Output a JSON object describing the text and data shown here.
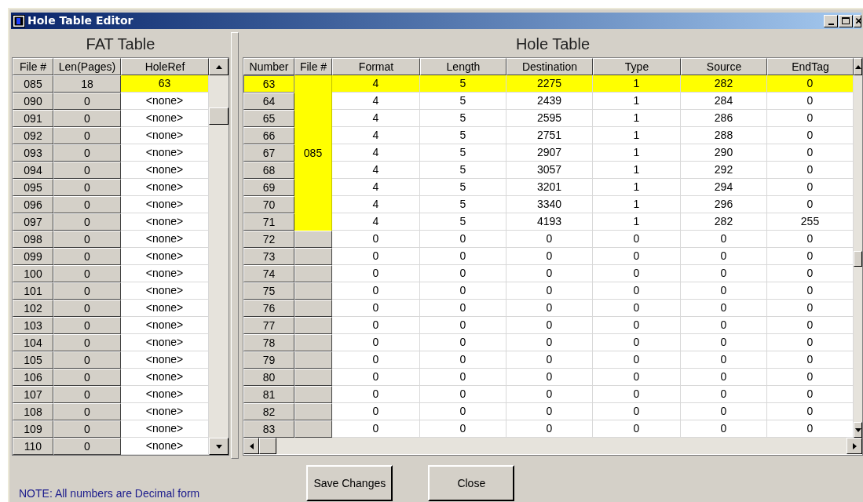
{
  "window": {
    "title": "Hole Table Editor"
  },
  "fat_table": {
    "title": "FAT Table",
    "columns": [
      "File #",
      "Len(Pages)",
      "HoleRef"
    ],
    "rows": [
      {
        "file": "085",
        "len": "18",
        "holeref": "63",
        "selected": true
      },
      {
        "file": "090",
        "len": "0",
        "holeref": "<none>",
        "selected": false
      },
      {
        "file": "091",
        "len": "0",
        "holeref": "<none>",
        "selected": false
      },
      {
        "file": "092",
        "len": "0",
        "holeref": "<none>",
        "selected": false
      },
      {
        "file": "093",
        "len": "0",
        "holeref": "<none>",
        "selected": false
      },
      {
        "file": "094",
        "len": "0",
        "holeref": "<none>",
        "selected": false
      },
      {
        "file": "095",
        "len": "0",
        "holeref": "<none>",
        "selected": false
      },
      {
        "file": "096",
        "len": "0",
        "holeref": "<none>",
        "selected": false
      },
      {
        "file": "097",
        "len": "0",
        "holeref": "<none>",
        "selected": false
      },
      {
        "file": "098",
        "len": "0",
        "holeref": "<none>",
        "selected": false
      },
      {
        "file": "099",
        "len": "0",
        "holeref": "<none>",
        "selected": false
      },
      {
        "file": "100",
        "len": "0",
        "holeref": "<none>",
        "selected": false
      },
      {
        "file": "101",
        "len": "0",
        "holeref": "<none>",
        "selected": false
      },
      {
        "file": "102",
        "len": "0",
        "holeref": "<none>",
        "selected": false
      },
      {
        "file": "103",
        "len": "0",
        "holeref": "<none>",
        "selected": false
      },
      {
        "file": "104",
        "len": "0",
        "holeref": "<none>",
        "selected": false
      },
      {
        "file": "105",
        "len": "0",
        "holeref": "<none>",
        "selected": false
      },
      {
        "file": "106",
        "len": "0",
        "holeref": "<none>",
        "selected": false
      },
      {
        "file": "107",
        "len": "0",
        "holeref": "<none>",
        "selected": false
      },
      {
        "file": "108",
        "len": "0",
        "holeref": "<none>",
        "selected": false
      },
      {
        "file": "109",
        "len": "0",
        "holeref": "<none>",
        "selected": false
      },
      {
        "file": "110",
        "len": "0",
        "holeref": "<none>",
        "selected": false
      }
    ]
  },
  "hole_table": {
    "title": "Hole Table",
    "columns": [
      "Number",
      "File #",
      "Format",
      "Length",
      "Destination",
      "Type",
      "Source",
      "EndTag"
    ],
    "rows": [
      {
        "in_file_group": true,
        "selected": true,
        "cells": [
          "63",
          "",
          "4",
          "5",
          "2275",
          "1",
          "282",
          "0"
        ]
      },
      {
        "in_file_group": true,
        "selected": false,
        "cells": [
          "64",
          "",
          "4",
          "5",
          "2439",
          "1",
          "284",
          "0"
        ]
      },
      {
        "in_file_group": true,
        "selected": false,
        "cells": [
          "65",
          "",
          "4",
          "5",
          "2595",
          "1",
          "286",
          "0"
        ]
      },
      {
        "in_file_group": true,
        "selected": false,
        "cells": [
          "66",
          "",
          "4",
          "5",
          "2751",
          "1",
          "288",
          "0"
        ]
      },
      {
        "in_file_group": true,
        "selected": false,
        "cells": [
          "67",
          "085",
          "4",
          "5",
          "2907",
          "1",
          "290",
          "0"
        ]
      },
      {
        "in_file_group": true,
        "selected": false,
        "cells": [
          "68",
          "",
          "4",
          "5",
          "3057",
          "1",
          "292",
          "0"
        ]
      },
      {
        "in_file_group": true,
        "selected": false,
        "cells": [
          "69",
          "",
          "4",
          "5",
          "3201",
          "1",
          "294",
          "0"
        ]
      },
      {
        "in_file_group": true,
        "selected": false,
        "cells": [
          "70",
          "",
          "4",
          "5",
          "3340",
          "1",
          "296",
          "0"
        ]
      },
      {
        "in_file_group": true,
        "selected": false,
        "cells": [
          "71",
          "",
          "4",
          "5",
          "4193",
          "1",
          "282",
          "255"
        ]
      },
      {
        "in_file_group": false,
        "selected": false,
        "cells": [
          "72",
          "",
          "0",
          "0",
          "0",
          "0",
          "0",
          "0"
        ]
      },
      {
        "in_file_group": false,
        "selected": false,
        "cells": [
          "73",
          "",
          "0",
          "0",
          "0",
          "0",
          "0",
          "0"
        ]
      },
      {
        "in_file_group": false,
        "selected": false,
        "cells": [
          "74",
          "",
          "0",
          "0",
          "0",
          "0",
          "0",
          "0"
        ]
      },
      {
        "in_file_group": false,
        "selected": false,
        "cells": [
          "75",
          "",
          "0",
          "0",
          "0",
          "0",
          "0",
          "0"
        ]
      },
      {
        "in_file_group": false,
        "selected": false,
        "cells": [
          "76",
          "",
          "0",
          "0",
          "0",
          "0",
          "0",
          "0"
        ]
      },
      {
        "in_file_group": false,
        "selected": false,
        "cells": [
          "77",
          "",
          "0",
          "0",
          "0",
          "0",
          "0",
          "0"
        ]
      },
      {
        "in_file_group": false,
        "selected": false,
        "cells": [
          "78",
          "",
          "0",
          "0",
          "0",
          "0",
          "0",
          "0"
        ]
      },
      {
        "in_file_group": false,
        "selected": false,
        "cells": [
          "79",
          "",
          "0",
          "0",
          "0",
          "0",
          "0",
          "0"
        ]
      },
      {
        "in_file_group": false,
        "selected": false,
        "cells": [
          "80",
          "",
          "0",
          "0",
          "0",
          "0",
          "0",
          "0"
        ]
      },
      {
        "in_file_group": false,
        "selected": false,
        "cells": [
          "81",
          "",
          "0",
          "0",
          "0",
          "0",
          "0",
          "0"
        ]
      },
      {
        "in_file_group": false,
        "selected": false,
        "cells": [
          "82",
          "",
          "0",
          "0",
          "0",
          "0",
          "0",
          "0"
        ]
      },
      {
        "in_file_group": false,
        "selected": false,
        "cells": [
          "83",
          "",
          "0",
          "0",
          "0",
          "0",
          "0",
          "0"
        ]
      }
    ]
  },
  "note": "NOTE: All numbers are Decimal form",
  "buttons": [
    "Save Changes",
    "Close"
  ]
}
